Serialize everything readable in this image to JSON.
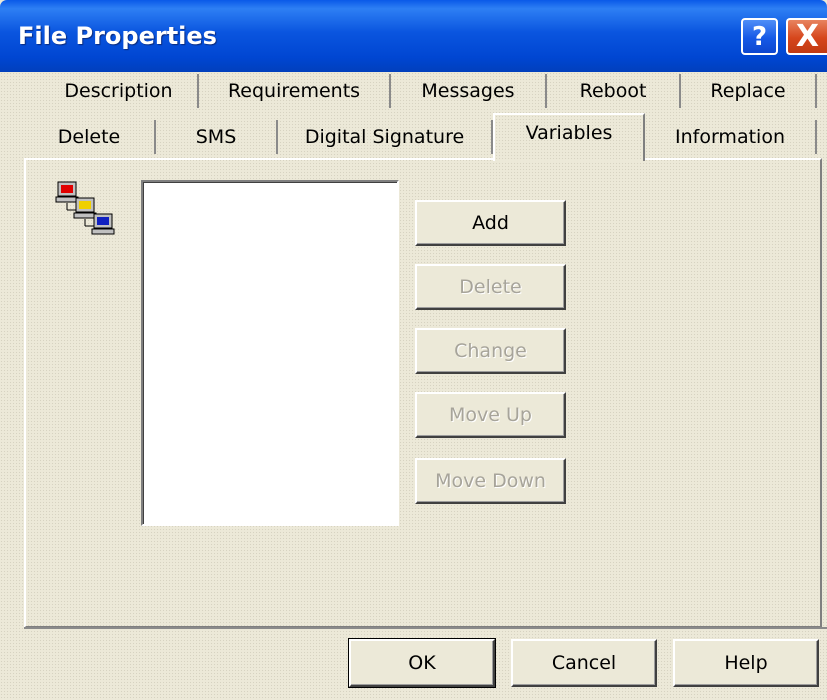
{
  "window": {
    "title": "File Properties"
  },
  "titlebar_buttons": {
    "help": "?",
    "close": "X"
  },
  "tabs_row1": [
    "Description",
    "Requirements",
    "Messages",
    "Reboot",
    "Replace"
  ],
  "tabs_row2": [
    "Delete",
    "SMS",
    "Digital Signature",
    "Variables",
    "Information"
  ],
  "selected_tab": "Variables",
  "variables": {
    "items": [],
    "buttons": {
      "add": "Add",
      "delete": "Delete",
      "change": "Change",
      "move_up": "Move Up",
      "move_down": "Move Down"
    }
  },
  "footer": {
    "ok": "OK",
    "cancel": "Cancel",
    "help": "Help"
  },
  "icons": {
    "variables": "networked-computers-icon"
  }
}
